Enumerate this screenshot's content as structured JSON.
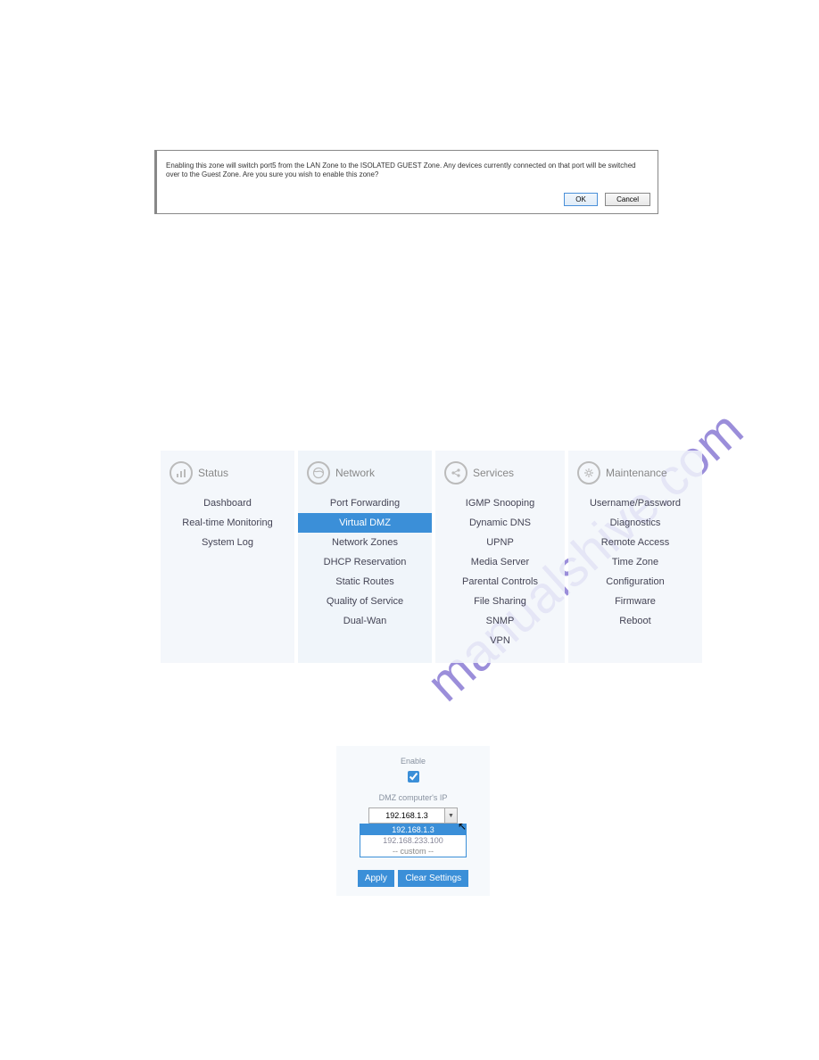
{
  "dialog": {
    "message": "Enabling this zone will switch port5 from the LAN Zone to the ISOLATED GUEST Zone. Any devices currently connected on that port will be switched over to the Guest Zone. Are you sure you wish to enable this zone?",
    "ok": "OK",
    "cancel": "Cancel"
  },
  "watermark": "manualshive.com",
  "menu": {
    "status": {
      "header": "Status",
      "items": [
        "Dashboard",
        "Real-time Monitoring",
        "System Log"
      ]
    },
    "network": {
      "header": "Network",
      "items": [
        "Port Forwarding",
        "Virtual DMZ",
        "Network Zones",
        "DHCP Reservation",
        "Static Routes",
        "Quality of Service",
        "Dual-Wan"
      ],
      "active_index": 1
    },
    "services": {
      "header": "Services",
      "items": [
        "IGMP Snooping",
        "Dynamic DNS",
        "UPNP",
        "Media Server",
        "Parental Controls",
        "File Sharing",
        "SNMP",
        "VPN"
      ]
    },
    "maintenance": {
      "header": "Maintenance",
      "items": [
        "Username/Password",
        "Diagnostics",
        "Remote Access",
        "Time Zone",
        "Configuration",
        "Firmware",
        "Reboot"
      ]
    }
  },
  "dmz": {
    "enable_label": "Enable",
    "ip_label": "DMZ computer's IP",
    "selected_ip": "192.168.1.3",
    "options": [
      "192.168.1.3",
      "192.168.233.100",
      "-- custom --"
    ],
    "apply": "Apply",
    "clear": "Clear Settings"
  }
}
